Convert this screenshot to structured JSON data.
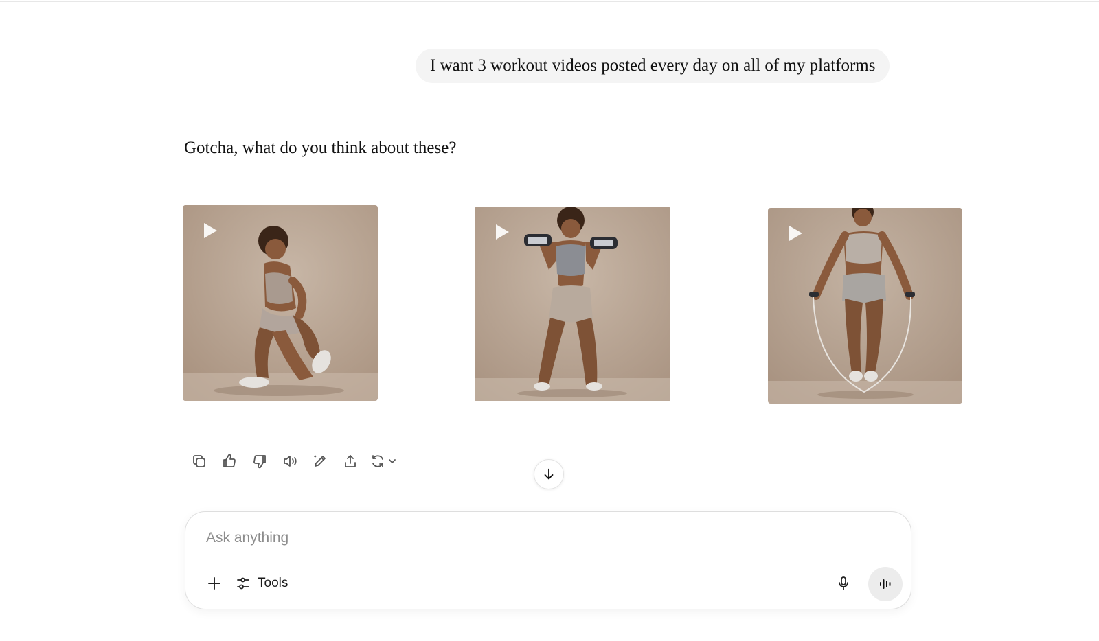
{
  "conversation": {
    "user_message": "I want 3 workout videos posted every day on all of my platforms",
    "assistant_message": "Gotcha, what do you think about these?"
  },
  "videos": [
    {
      "label": "kneeling lunge pose",
      "icon": "play-icon"
    },
    {
      "label": "dumbbell shoulder press pose",
      "icon": "play-icon"
    },
    {
      "label": "jump rope pose",
      "icon": "play-icon"
    }
  ],
  "actions": [
    "copy-icon",
    "thumbs-up-icon",
    "thumbs-down-icon",
    "read-aloud-icon",
    "edit-icon",
    "share-icon",
    "regenerate-icon"
  ],
  "composer": {
    "placeholder": "Ask anything",
    "tools_label": "Tools"
  },
  "colors": {
    "bubble": "#f4f4f4",
    "background": "#ffffff",
    "video_backdrop": "#b9a593",
    "voice_button": "#ececec"
  }
}
